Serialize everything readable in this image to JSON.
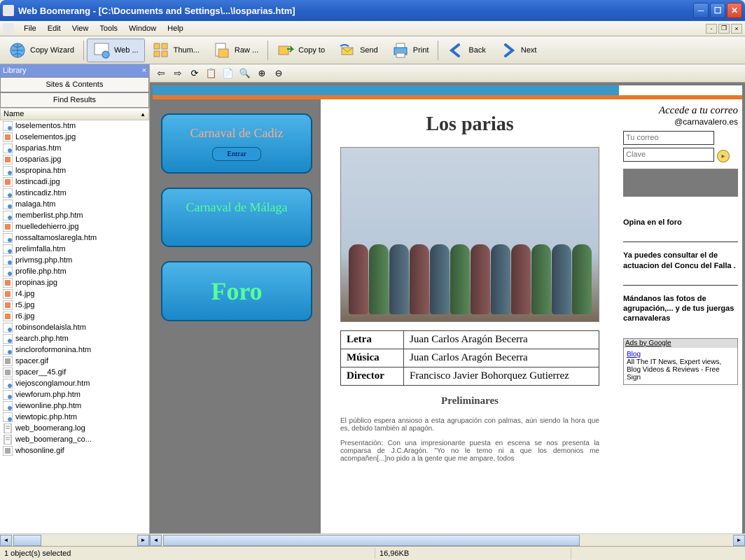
{
  "window": {
    "title": "Web Boomerang - [C:\\Documents and Settings\\...\\losparias.htm]"
  },
  "menu": [
    "File",
    "Edit",
    "View",
    "Tools",
    "Window",
    "Help"
  ],
  "toolbar": [
    {
      "label": "Copy Wizard",
      "icon": "globe"
    },
    {
      "label": "Web ...",
      "icon": "web",
      "selected": true
    },
    {
      "label": "Thum...",
      "icon": "thumb"
    },
    {
      "label": "Raw ...",
      "icon": "raw"
    },
    {
      "label": "Copy to",
      "icon": "copyto"
    },
    {
      "label": "Send",
      "icon": "send"
    },
    {
      "label": "Print",
      "icon": "print"
    },
    {
      "label": "Back",
      "icon": "back"
    },
    {
      "label": "Next",
      "icon": "next"
    }
  ],
  "sidebar": {
    "header": "Library",
    "tabs": [
      "Sites & Contents",
      "Find Results"
    ],
    "column": "Name",
    "files": [
      {
        "name": "loselementos.htm",
        "type": "htm"
      },
      {
        "name": "Loselementos.jpg",
        "type": "jpg"
      },
      {
        "name": "losparias.htm",
        "type": "htm"
      },
      {
        "name": "Losparias.jpg",
        "type": "jpg"
      },
      {
        "name": "lospropina.htm",
        "type": "htm"
      },
      {
        "name": "lostincadi.jpg",
        "type": "jpg"
      },
      {
        "name": "lostincadiz.htm",
        "type": "htm"
      },
      {
        "name": "malaga.htm",
        "type": "htm"
      },
      {
        "name": "memberlist.php.htm",
        "type": "htm"
      },
      {
        "name": "muelledehierro.jpg",
        "type": "jpg"
      },
      {
        "name": "nossaltamoslaregla.htm",
        "type": "htm"
      },
      {
        "name": "prelimfalla.htm",
        "type": "htm"
      },
      {
        "name": "privmsg.php.htm",
        "type": "htm"
      },
      {
        "name": "profile.php.htm",
        "type": "htm"
      },
      {
        "name": "propinas.jpg",
        "type": "jpg"
      },
      {
        "name": "r4.jpg",
        "type": "jpg"
      },
      {
        "name": "r5.jpg",
        "type": "jpg"
      },
      {
        "name": "r6.jpg",
        "type": "jpg"
      },
      {
        "name": "robinsondelaisla.htm",
        "type": "htm"
      },
      {
        "name": "search.php.htm",
        "type": "htm"
      },
      {
        "name": "sincloroformonina.htm",
        "type": "htm"
      },
      {
        "name": "spacer.gif",
        "type": "gif"
      },
      {
        "name": "spacer__45.gif",
        "type": "gif"
      },
      {
        "name": "viejosconglamour.htm",
        "type": "htm"
      },
      {
        "name": "viewforum.php.htm",
        "type": "htm"
      },
      {
        "name": "viewonline.php.htm",
        "type": "htm"
      },
      {
        "name": "viewtopic.php.htm",
        "type": "htm"
      },
      {
        "name": "web_boomerang.log",
        "type": "log"
      },
      {
        "name": "web_boomerang_co...",
        "type": "log"
      },
      {
        "name": "whosonline.gif",
        "type": "gif"
      }
    ]
  },
  "page": {
    "title": "Los parias",
    "nav": {
      "cadiz": "Carnaval de Cadiz",
      "entrar": "Entrar",
      "malaga": "Carnaval de Málaga",
      "foro": "Foro"
    },
    "info": {
      "letra_label": "Letra",
      "letra": "Juan Carlos Aragón Becerra",
      "musica_label": "Música",
      "musica": "Juan Carlos Aragón Becerra",
      "director_label": "Director",
      "director": "Francisco Javier Bohorquez Gutierrez"
    },
    "section": "Preliminares",
    "para1": "El público espera ansioso a esta agrupación con palmas, aún siendo la hora que es, debido también al apagón.",
    "para2": "Presentación: Con una impresionante puesta en escena se nos presenta la comparsa de J.C.Aragón. \"Yo no le temo ni a que los demonios me acompañen[...]no pido a la gente que me ampare, todos",
    "right": {
      "email_title": "Accede a tu correo",
      "email_sub": "@carnavalero.es",
      "correo_placeholder": "Tu correo",
      "clave_placeholder": "Clave",
      "opina": "Opina en el foro",
      "consultar": "Ya puedes consultar el de actuacion del Concu del Falla .",
      "fotos": "Mándanos las fotos de agrupación,... y de tus juergas carnavaleras",
      "ads_title": "Ads by Google",
      "ads_link": "Blog",
      "ads_text": "All The IT News, Expert views, Blog Videos & Reviews - Free Sign"
    }
  },
  "status": {
    "selected": "1 object(s) selected",
    "size": "16,96KB"
  }
}
